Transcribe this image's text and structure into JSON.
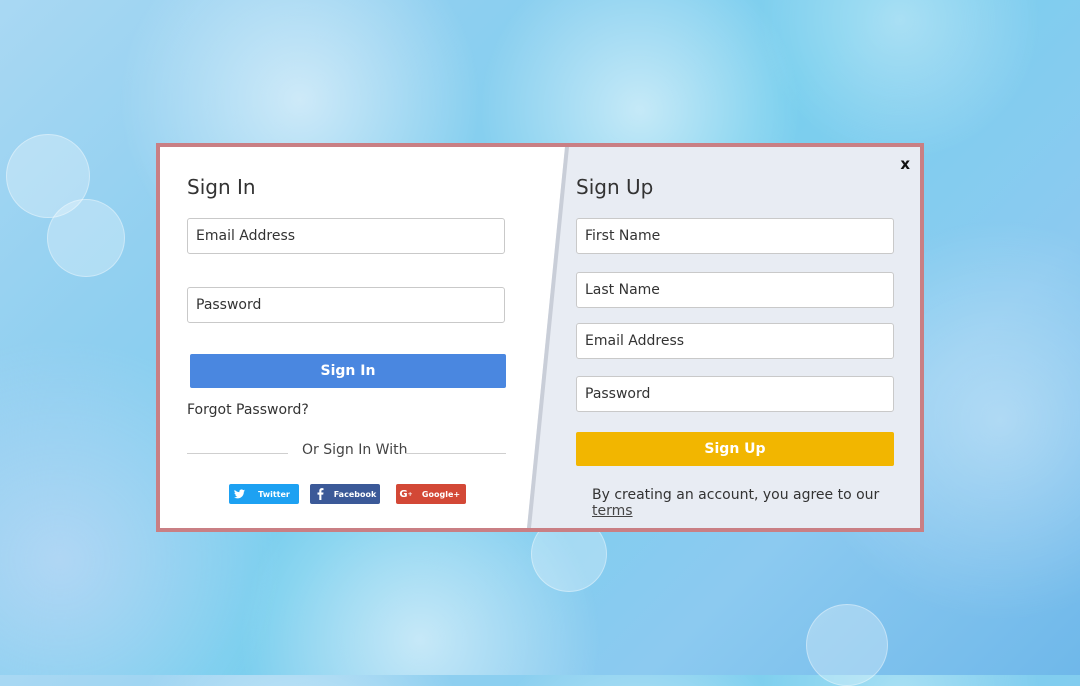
{
  "close": {
    "label": "x"
  },
  "sign_in": {
    "title": "Sign In",
    "email_placeholder": "Email Address",
    "password_placeholder": "Password",
    "submit_label": "Sign In",
    "forgot_label": "Forgot Password?",
    "or_label": "Or Sign In With",
    "social": [
      {
        "label": "Twitter",
        "icon": "twitter-icon",
        "color": "#1da1f2"
      },
      {
        "label": "Facebook",
        "icon": "facebook-icon",
        "color": "#3b5998"
      },
      {
        "label": "Google+",
        "icon": "google-plus-icon",
        "color": "#d34836"
      }
    ]
  },
  "sign_up": {
    "title": "Sign Up",
    "first_name_placeholder": "First Name",
    "last_name_placeholder": "Last Name",
    "email_placeholder": "Email Address",
    "password_placeholder": "Password",
    "submit_label": "Sign Up",
    "terms_prefix": "By creating an account, you agree to our ",
    "terms_link": "terms"
  },
  "colors": {
    "modal_border": "#c97f84",
    "sign_in_button": "#4a87e0",
    "sign_up_button": "#f2b600"
  }
}
